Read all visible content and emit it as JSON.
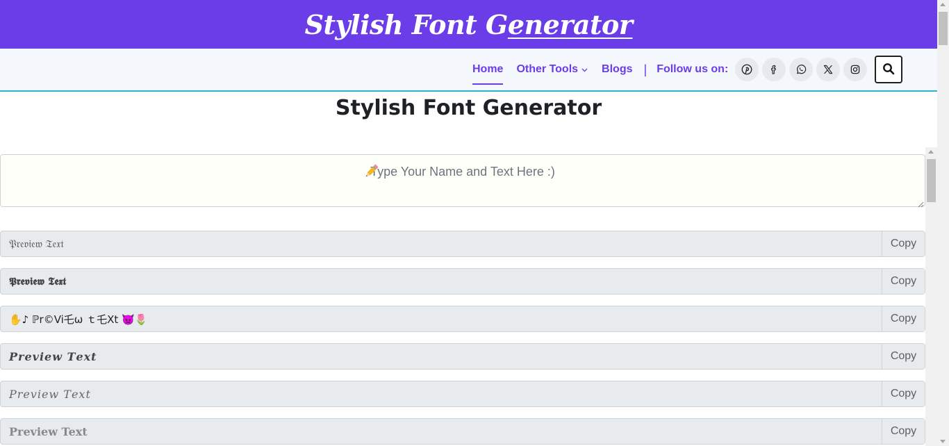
{
  "site": {
    "brand_part1": "Stylish Font G",
    "brand_part2": "enerator"
  },
  "nav": {
    "home": "Home",
    "other_tools": "Other Tools",
    "blogs": "Blogs",
    "separator": "|",
    "follow": "Follow us on:",
    "social_icons": [
      "pinterest-icon",
      "facebook-icon",
      "whatsapp-icon",
      "x-icon",
      "instagram-icon"
    ],
    "search_icon": "search-icon"
  },
  "main": {
    "title": "Stylish Font Generator",
    "input_placeholder": "Type Your Name and Text Here :)",
    "input_icon": "pencil-icon"
  },
  "rows": [
    {
      "text": "𝔓𝔯𝔢𝔳𝔦𝔢𝔴 𝔗𝔢𝔵𝔱",
      "copy": "Copy"
    },
    {
      "text": "𝕻𝖗𝖊𝖛𝖎𝖊𝖜 𝕿𝖊𝖝𝖙",
      "copy": "Copy"
    },
    {
      "text": "✋♪ ℙr©Vi乇ω ｔ乇Xt 👿🌷",
      "copy": "Copy"
    },
    {
      "text": "𝑷𝒓𝒆𝒗𝒊𝒆𝒘 𝑻𝒆𝒙𝒕",
      "copy": "Copy"
    },
    {
      "text": "𝑃𝑟𝑒𝑣𝑖𝑒𝑤 𝑇𝑒𝑥𝑡",
      "copy": "Copy"
    },
    {
      "text": "Preview Text",
      "copy": "Copy"
    }
  ],
  "colors": {
    "brand_purple": "#6a3de8",
    "nav_border": "#29b6c9",
    "row_bg": "#e8ebee"
  }
}
